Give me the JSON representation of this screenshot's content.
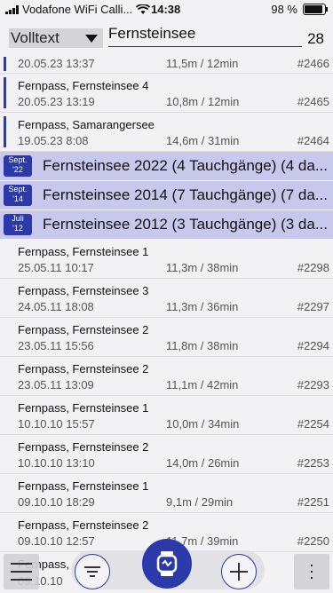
{
  "status": {
    "carrier": "Vodafone WiFi Calli...",
    "time": "14:38",
    "battery": "98 %",
    "battery_level": 0.98
  },
  "search": {
    "mode": "Volltext",
    "query": "Fernsteinsee",
    "result_count": "28"
  },
  "top_row": {
    "date": "20.05.23 13:37",
    "stat": "11,5m / 12min",
    "num": "#2466"
  },
  "dives_a": [
    {
      "name": "Fernpass, Fernsteinsee 4",
      "date": "20.05.23 13:19",
      "stat": "10,8m / 12min",
      "num": "#2465"
    },
    {
      "name": "Fernpass, Samarangersee",
      "date": "19.05.23 8:08",
      "stat": "14,6m / 31min",
      "num": "#2464"
    }
  ],
  "trips": [
    {
      "month": "Sept.",
      "year": "'22",
      "title": "Fernsteinsee 2022 (4 Tauchgänge) (4 da..."
    },
    {
      "month": "Sept.",
      "year": "'14",
      "title": "Fernsteinsee 2014 (7 Tauchgänge) (7 da..."
    },
    {
      "month": "Juli",
      "year": "'12",
      "title": "Fernsteinsee 2012 (3 Tauchgänge) (3 da..."
    }
  ],
  "dives_b": [
    {
      "name": "Fernpass, Fernsteinsee 1",
      "date": "25.05.11 10:17",
      "stat": "11,3m / 38min",
      "num": "#2298"
    },
    {
      "name": "Fernpass, Fernsteinsee 3",
      "date": "24.05.11 18:08",
      "stat": "11,3m / 36min",
      "num": "#2297"
    },
    {
      "name": "Fernpass, Fernsteinsee 2",
      "date": "23.05.11 15:56",
      "stat": "11,8m / 38min",
      "num": "#2294"
    },
    {
      "name": "Fernpass, Fernsteinsee 2",
      "date": "23.05.11 13:09",
      "stat": "11,1m / 42min",
      "num": "#2293"
    },
    {
      "name": "Fernpass, Fernsteinsee 1",
      "date": "10.10.10 15:57",
      "stat": "10,0m / 34min",
      "num": "#2254"
    },
    {
      "name": "Fernpass, Fernsteinsee 2",
      "date": "10.10.10 13:10",
      "stat": "14,0m / 26min",
      "num": "#2253"
    },
    {
      "name": "Fernpass, Fernsteinsee 1",
      "date": "09.10.10 18:29",
      "stat": "9,1m / 29min",
      "num": "#2251"
    },
    {
      "name": "Fernpass, Fernsteinsee 2",
      "date": "09.10.10 12:57",
      "stat": "11,7m / 39min",
      "num": "#2250"
    },
    {
      "name": "Fernpass, ...",
      "date": "09.10.10",
      "stat": "",
      "num": ""
    }
  ],
  "colors": {
    "accent": "#2b3aa8",
    "trip_bg": "#c8c8ec",
    "marker": "#333e8f"
  }
}
